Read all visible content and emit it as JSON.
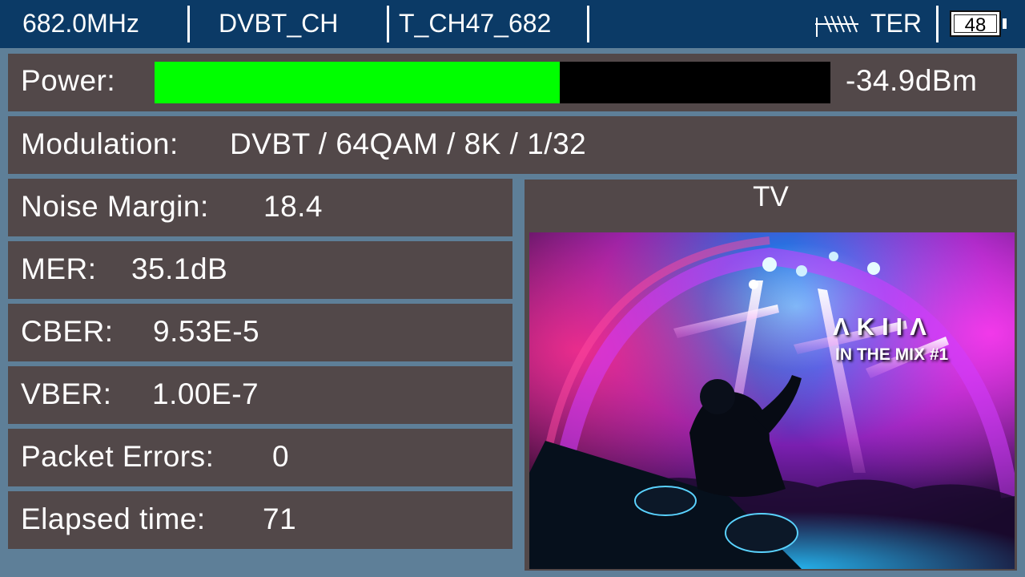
{
  "status_bar": {
    "frequency": "682.0MHz",
    "channel_plan": "DVBT_CH",
    "channel_name": "T_CH47_682",
    "band": "TER",
    "battery_level": "48",
    "antenna_icon": "antenna-icon"
  },
  "power": {
    "label": "Power:",
    "value": "-34.9dBm",
    "fill_percent": 60,
    "fill_color": "#00ff00"
  },
  "modulation": {
    "label": "Modulation:",
    "value": "DVBT / 64QAM / 8K / 1/32"
  },
  "measurements": [
    {
      "label": "Noise Margin:",
      "value": "18.4"
    },
    {
      "label": "MER:",
      "value": "35.1dB"
    },
    {
      "label": "CBER:",
      "value": "9.53E-5"
    },
    {
      "label": "VBER:",
      "value": "1.00E-7"
    },
    {
      "label": "Packet Errors:",
      "value": "0"
    },
    {
      "label": "Elapsed time:",
      "value": "71"
    }
  ],
  "tv": {
    "title": "TV",
    "overlay_title": "ΛΚΙΙΛ",
    "overlay_subtitle": "IN THE MIX #1"
  },
  "colors": {
    "top_bar": "#0b3a66",
    "panel": "#524849",
    "background": "#5e7f98",
    "power_fill": "#00ff00"
  }
}
